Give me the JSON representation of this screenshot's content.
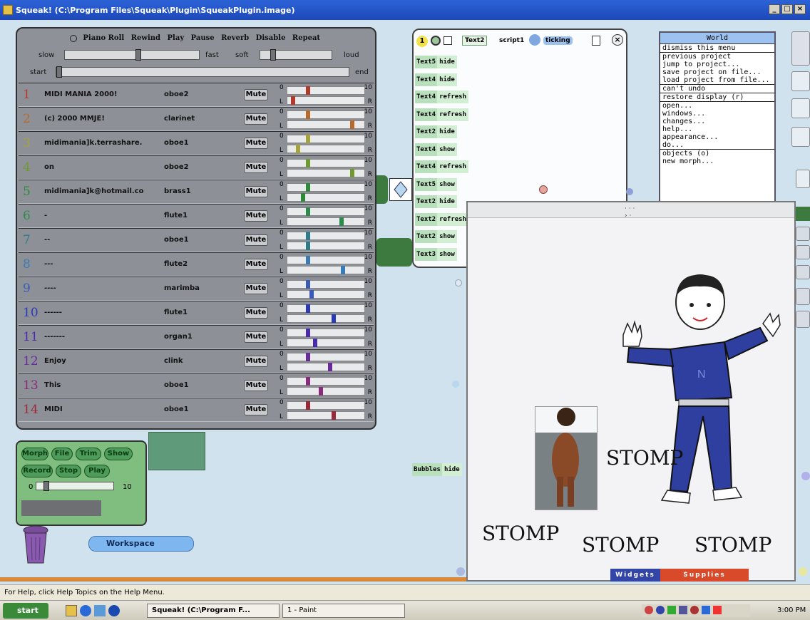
{
  "window": {
    "title": "Squeak! (C:\\Program Files\\Squeak\\Plugin\\SqueakPlugin.image)",
    "buttons": [
      "_",
      "□",
      "×"
    ]
  },
  "piano_roll": {
    "top_buttons": [
      "Piano Roll",
      "Rewind",
      "Play",
      "Pause",
      "Reverb",
      "Disable",
      "Repeat"
    ],
    "tempo_slow": "slow",
    "tempo_fast": "fast",
    "volume_soft": "soft",
    "volume_loud": "loud",
    "position_start": "start",
    "position_end": "end",
    "tempo_level": 0.55,
    "volume_level": 0.15,
    "position_level": 0.0,
    "tracks": [
      {
        "num": "1",
        "name": "MIDI MANIA 2000!",
        "instrument": "oboe2",
        "mute": "Mute",
        "color": "#b33a2a",
        "vol": 0.25,
        "pan": 0.05
      },
      {
        "num": "2",
        "name": "(c) 2000 MMJE!",
        "instrument": "clarinet",
        "mute": "Mute",
        "color": "#b96a2a",
        "vol": 0.25,
        "pan": 0.85
      },
      {
        "num": "3",
        "name": "midimania]k.terrashare.",
        "instrument": "oboe1",
        "mute": "Mute",
        "color": "#a8a23a",
        "vol": 0.25,
        "pan": 0.12
      },
      {
        "num": "4",
        "name": "on",
        "instrument": "oboe2",
        "mute": "Mute",
        "color": "#6e9a2e",
        "vol": 0.25,
        "pan": 0.85
      },
      {
        "num": "5",
        "name": "midimania]k@hotmail.co",
        "instrument": "brass1",
        "mute": "Mute",
        "color": "#2e8a3a",
        "vol": 0.25,
        "pan": 0.18
      },
      {
        "num": "6",
        "name": "-",
        "instrument": "flute1",
        "mute": "Mute",
        "color": "#2e8a4a",
        "vol": 0.25,
        "pan": 0.7
      },
      {
        "num": "7",
        "name": "--",
        "instrument": "oboe1",
        "mute": "Mute",
        "color": "#2e7a8a",
        "vol": 0.25,
        "pan": 0.25
      },
      {
        "num": "8",
        "name": "---",
        "instrument": "flute2",
        "mute": "Mute",
        "color": "#3a7ab6",
        "vol": 0.25,
        "pan": 0.72
      },
      {
        "num": "9",
        "name": "----",
        "instrument": "marimba",
        "mute": "Mute",
        "color": "#3a5ab6",
        "vol": 0.25,
        "pan": 0.3
      },
      {
        "num": "10",
        "name": "------",
        "instrument": "flute1",
        "mute": "Mute",
        "color": "#2a3ab6",
        "vol": 0.25,
        "pan": 0.6
      },
      {
        "num": "11",
        "name": "-------",
        "instrument": "organ1",
        "mute": "Mute",
        "color": "#4a2ab0",
        "vol": 0.25,
        "pan": 0.35
      },
      {
        "num": "12",
        "name": "Enjoy",
        "instrument": "clink",
        "mute": "Mute",
        "color": "#6a2a9a",
        "vol": 0.25,
        "pan": 0.55
      },
      {
        "num": "13",
        "name": "This",
        "instrument": "oboe1",
        "mute": "Mute",
        "color": "#8a2a7a",
        "vol": 0.25,
        "pan": 0.42
      },
      {
        "num": "14",
        "name": "MIDI",
        "instrument": "oboe1",
        "mute": "Mute",
        "color": "#9a2a3a",
        "vol": 0.25,
        "pan": 0.6
      }
    ],
    "slider_left_top": "0",
    "slider_left_bottom": "L",
    "slider_right_top": "10",
    "slider_right_bottom": "R"
  },
  "script_panel": {
    "counter": "1",
    "name_tile": "Text2",
    "script_name": "script1",
    "status": "ticking",
    "lines": [
      {
        "obj": "Text5",
        "cmd": "hide"
      },
      {
        "obj": "Text4",
        "cmd": "hide"
      },
      {
        "obj": "Text4",
        "cmd": "refresh"
      },
      {
        "obj": "Text4",
        "cmd": "refresh"
      },
      {
        "obj": "Text2",
        "cmd": "hide"
      },
      {
        "obj": "Text4",
        "cmd": "show"
      },
      {
        "obj": "Text4",
        "cmd": "refresh"
      },
      {
        "obj": "Text5",
        "cmd": "show"
      },
      {
        "obj": "Text2",
        "cmd": "hide"
      },
      {
        "obj": "Text2",
        "cmd": "refresh"
      },
      {
        "obj": "Text2",
        "cmd": "show"
      },
      {
        "obj": "Text3",
        "cmd": "show"
      }
    ]
  },
  "world_menu": {
    "title": "World",
    "items": [
      "dismiss this menu",
      "previous project",
      "jump to project...",
      "save project on file...",
      "load project from file...",
      "can't undo",
      "restore display (r)",
      "open...",
      "windows...",
      "changes...",
      "help...",
      "appearance...",
      "do...",
      "objects (o)",
      "new morph..."
    ],
    "separators_before": [
      1,
      5,
      6,
      7,
      13
    ]
  },
  "bubbles_tile": {
    "obj": "Bubbles",
    "cmd": "hide"
  },
  "playfield": {
    "stomps": [
      "STOMP",
      "STOMP",
      "STOMP",
      "STOMP"
    ],
    "shirt_letter": "N"
  },
  "recorder": {
    "buttons_row1": [
      "Morph",
      "File",
      "Trim",
      "Show"
    ],
    "buttons_row2": [
      "Record",
      "Stop",
      "Play"
    ],
    "min": "0",
    "max": "10",
    "level": 0.1
  },
  "workspace_flap": {
    "label": "Workspace"
  },
  "bottom_tabs": {
    "widgets": "Widgets",
    "supplies": "Supplies"
  },
  "statusbar": {
    "text": "For Help, click Help Topics on the Help Menu."
  },
  "taskbar": {
    "start": "start",
    "task1": "Squeak! (C:\\Program F...",
    "task2": "1 - Paint",
    "clock": "3:00 PM"
  },
  "colors": {
    "piano_bg": "#8e9198",
    "recorder_bg": "#7fbe7f",
    "title_blue": "#2d63d8",
    "shirt_blue": "#2e3f9f",
    "tab_widgets": "#3346a8",
    "tab_supplies": "#d84a2a"
  }
}
